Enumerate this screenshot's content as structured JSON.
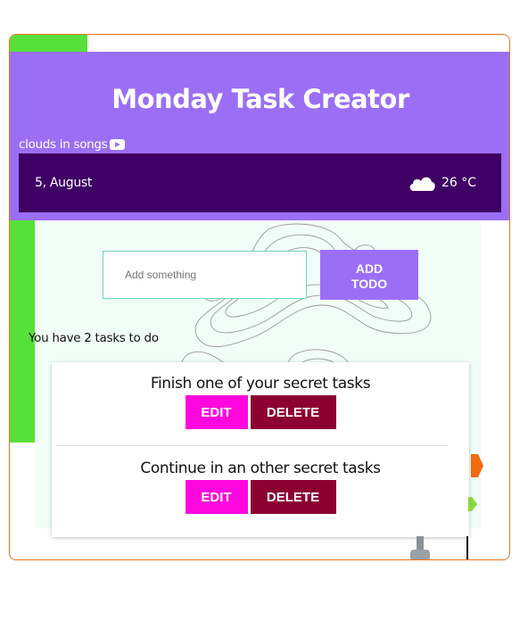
{
  "header": {
    "title": "Monday Task Creator",
    "music_link": "clouds in songs",
    "music_icon": "youtube-icon"
  },
  "weather": {
    "date": "5, August",
    "temperature": "26 °C",
    "icon": "cloud-icon"
  },
  "form": {
    "placeholder": "Add something",
    "value": "",
    "add_label": "ADD\nTODO"
  },
  "task_count": "You have 2 tasks to do",
  "tasks": [
    {
      "text": "Finish one of your secret tasks",
      "edit_label": "EDIT",
      "delete_label": "DELETE"
    },
    {
      "text": "Continue in an other secret tasks",
      "edit_label": "EDIT",
      "delete_label": "DELETE"
    }
  ],
  "colors": {
    "header": "#9b6ff5",
    "weather_bar": "#3f0065",
    "green_strip": "#56e03a",
    "edit": "#ff07de",
    "delete": "#8c0031",
    "frame_border": "#e8731c"
  }
}
